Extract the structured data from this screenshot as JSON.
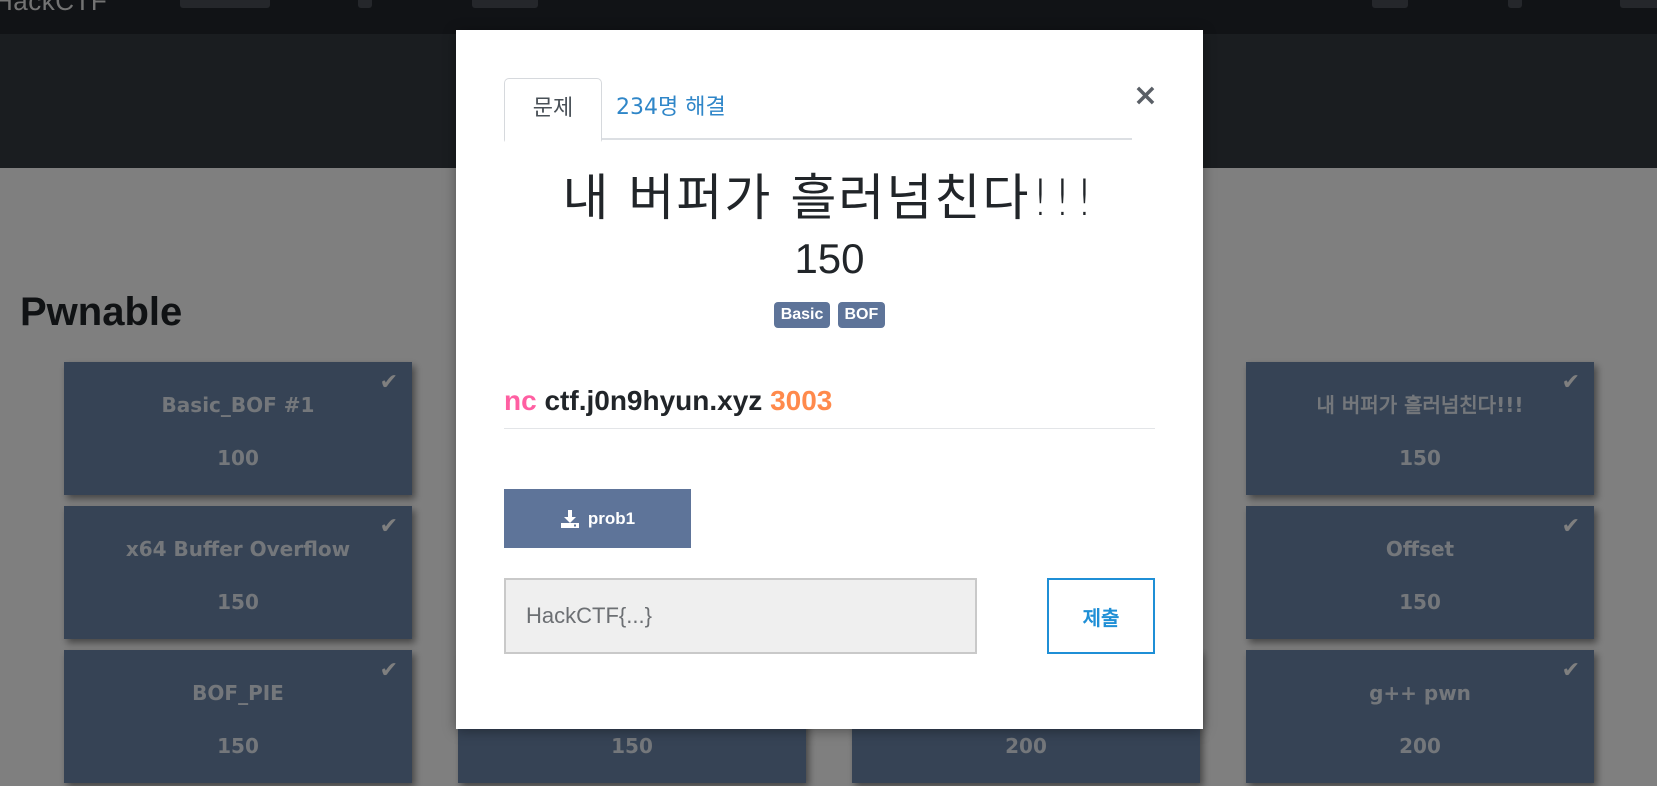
{
  "navbar": {
    "brand": "HackCTF"
  },
  "category": {
    "title": "Pwnable"
  },
  "cards": [
    {
      "title": "Basic_BOF #1",
      "points": "100",
      "solved": true
    },
    {
      "title": "내 버퍼가 흘러넘친다!!!",
      "points": "150",
      "solved": true
    },
    {
      "title": "x64 Buffer Overflow",
      "points": "150",
      "solved": true
    },
    {
      "title": "Offset",
      "points": "150",
      "solved": true
    },
    {
      "title": "BOF_PIE",
      "points": "150",
      "solved": true
    },
    {
      "title": "",
      "points": "150",
      "solved": false
    },
    {
      "title": "",
      "points": "200",
      "solved": false
    },
    {
      "title": "g++ pwn",
      "points": "200",
      "solved": true
    }
  ],
  "modal": {
    "tabs": [
      {
        "label": "문제",
        "active": true
      },
      {
        "label": "234명 해결",
        "active": false
      }
    ],
    "close_glyph": "×",
    "title": "내 버퍼가 흘러넘친다!!!",
    "points": "150",
    "tags": [
      "Basic",
      "BOF"
    ],
    "connection": {
      "cmd": "nc",
      "host": "ctf.j0n9hyun.xyz",
      "port": "3003"
    },
    "file": {
      "label": "prob1",
      "icon": "download-icon"
    },
    "flag_input": {
      "placeholder": "HackCTF{...}",
      "value": ""
    },
    "submit_label": "제출"
  },
  "colors": {
    "card": "#6c87aa",
    "tag": "#5e7499",
    "nc": "#ff5fa2",
    "port": "#ff8a4c",
    "submit": "#1f8fd6"
  }
}
